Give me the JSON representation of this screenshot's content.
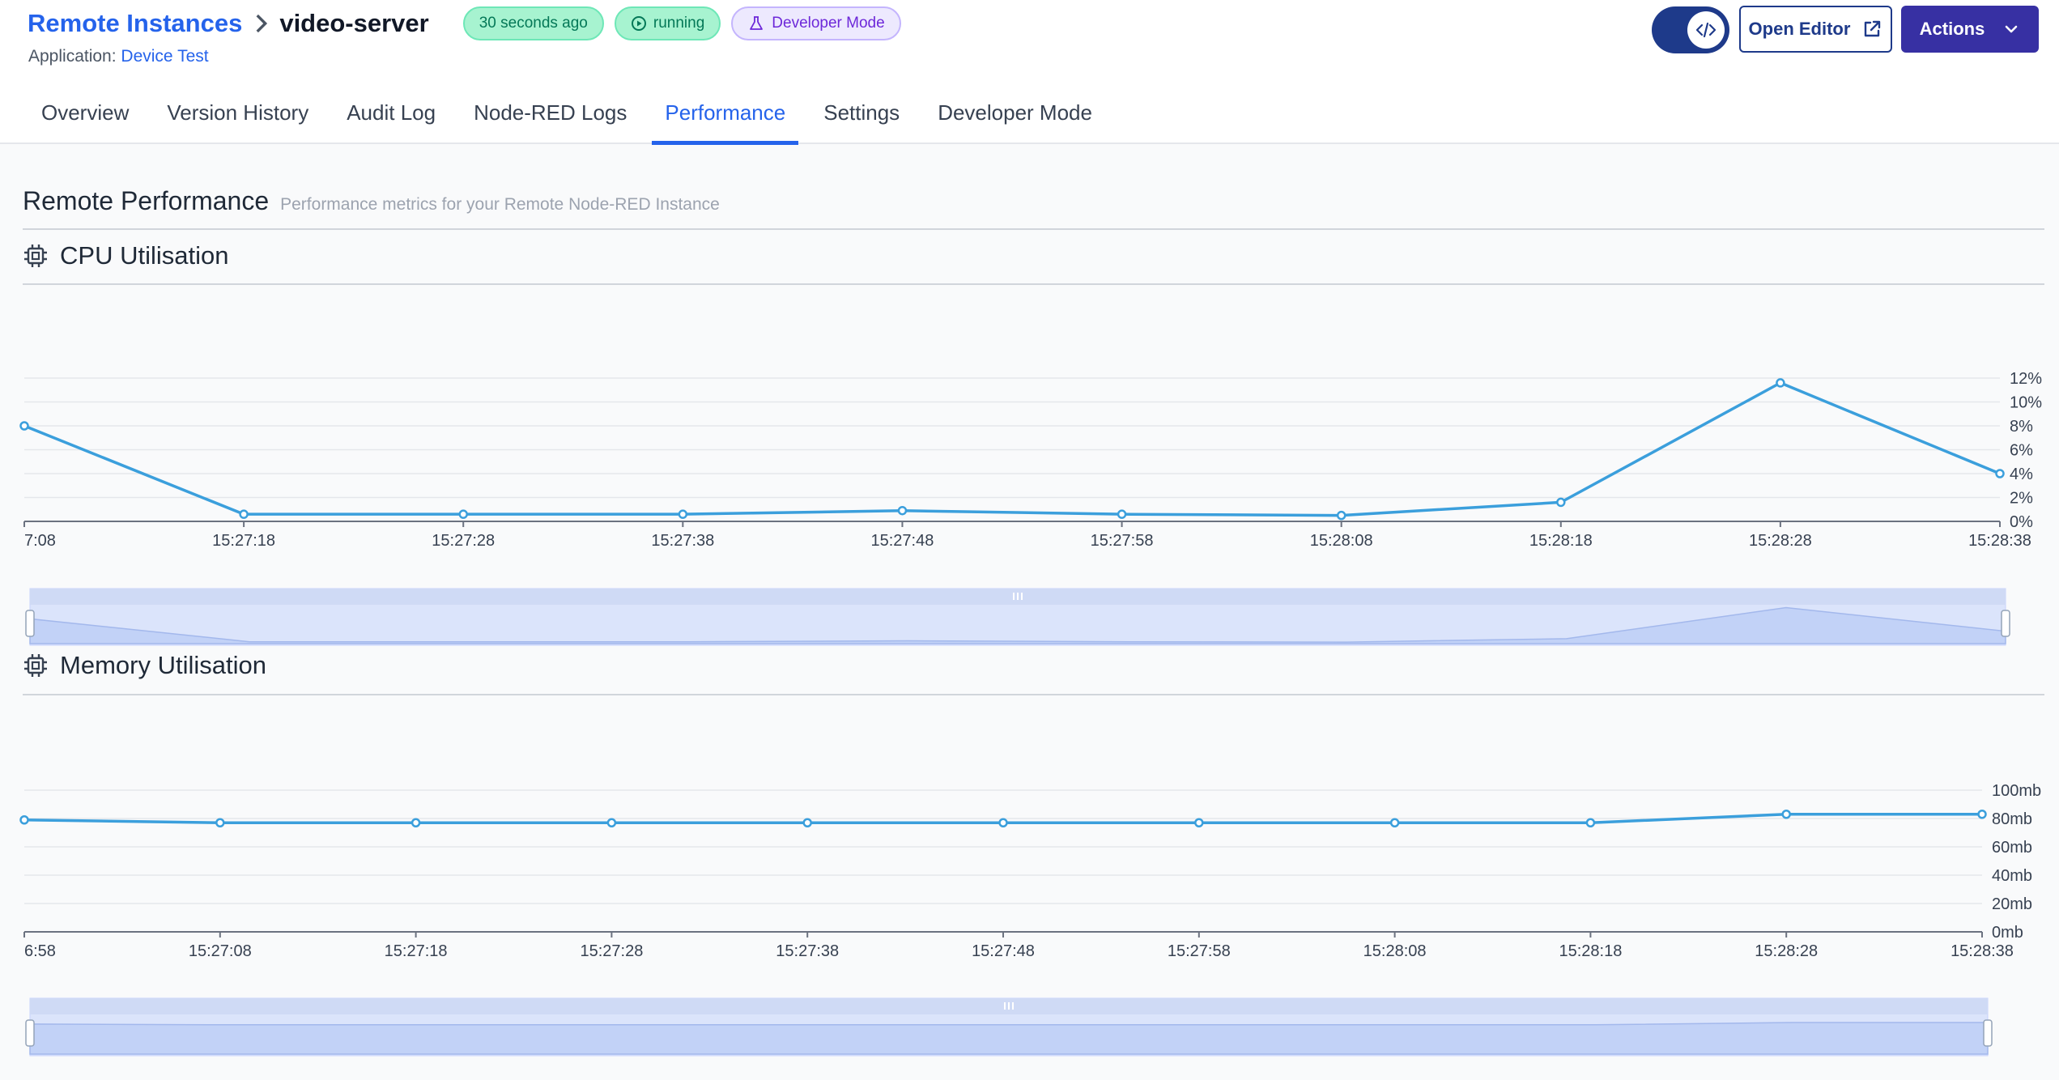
{
  "header": {
    "breadcrumb_root": "Remote Instances",
    "instance_name": "video-server",
    "badges": {
      "last_seen": "30 seconds ago",
      "status": "running",
      "mode": "Developer Mode"
    },
    "application_label": "Application:",
    "application_name": "Device Test",
    "open_editor_label": "Open Editor",
    "actions_label": "Actions"
  },
  "tabs": [
    {
      "label": "Overview"
    },
    {
      "label": "Version History"
    },
    {
      "label": "Audit Log"
    },
    {
      "label": "Node-RED Logs"
    },
    {
      "label": "Performance",
      "active": true
    },
    {
      "label": "Settings"
    },
    {
      "label": "Developer Mode"
    }
  ],
  "section": {
    "title": "Remote Performance",
    "subtitle": "Performance metrics for your Remote Node-RED Instance"
  },
  "colors": {
    "accent": "#2563eb",
    "line": "#3b9fdc",
    "slider_fill": "#dbe4fb"
  },
  "chart_data": [
    {
      "type": "line",
      "title": "CPU Utilisation",
      "x": [
        "7:08",
        "15:27:18",
        "15:27:28",
        "15:27:38",
        "15:27:48",
        "15:27:58",
        "15:28:08",
        "15:28:18",
        "15:28:28",
        "15:28:38"
      ],
      "y": [
        8,
        0.6,
        0.6,
        0.6,
        0.9,
        0.6,
        0.5,
        1.6,
        11.6,
        4
      ],
      "y_ticks": [
        "0%",
        "2%",
        "4%",
        "6%",
        "8%",
        "10%",
        "12%"
      ],
      "ylim": [
        0,
        12
      ],
      "y_axis_position": "right",
      "grid": true
    },
    {
      "type": "line",
      "title": "Memory Utilisation",
      "x": [
        "6:58",
        "15:27:08",
        "15:27:18",
        "15:27:28",
        "15:27:38",
        "15:27:48",
        "15:27:58",
        "15:28:08",
        "15:28:18",
        "15:28:28",
        "15:28:38"
      ],
      "y": [
        79,
        77,
        77,
        77,
        77,
        77,
        77,
        77,
        77,
        83,
        83
      ],
      "y_ticks": [
        "0mb",
        "20mb",
        "40mb",
        "60mb",
        "80mb",
        "100mb"
      ],
      "ylim": [
        0,
        100
      ],
      "y_axis_position": "right",
      "grid": true
    }
  ]
}
